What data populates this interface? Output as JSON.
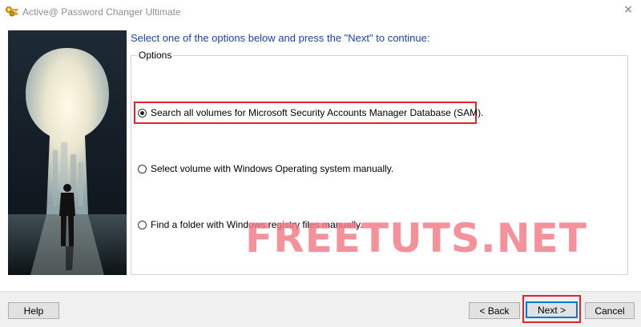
{
  "window": {
    "title": "Active@ Password Changer Ultimate",
    "close_glyph": "×",
    "icon": "keys-icon"
  },
  "main": {
    "heading": "Select one of the options below and press the \"Next\" to continue:",
    "group_label": "Options",
    "options": [
      {
        "label": "Search all volumes for Microsoft Security Accounts Manager Database (SAM).",
        "selected": true,
        "highlighted": true
      },
      {
        "label": "Select volume with Windows Operating system manually.",
        "selected": false
      },
      {
        "label": "Find a folder with Windows registry files manually.",
        "selected": false
      }
    ]
  },
  "footer": {
    "help_label": "Help",
    "back_label": "< Back",
    "next_label": "Next >",
    "cancel_label": "Cancel"
  },
  "watermark": "FREETUTS.NET",
  "colors": {
    "heading": "#1a44a8",
    "highlight": "#e1252a",
    "watermark": "#f47a86"
  }
}
